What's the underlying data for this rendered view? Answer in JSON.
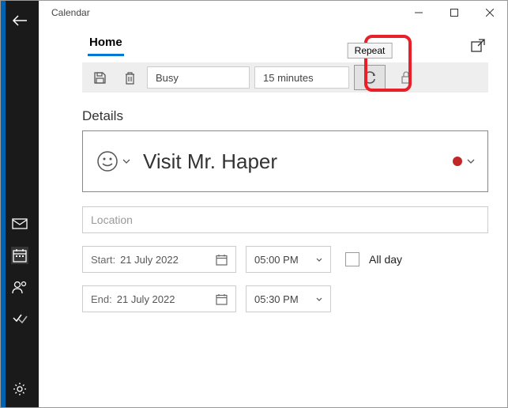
{
  "window": {
    "title": "Calendar"
  },
  "tabs": {
    "home": "Home"
  },
  "tooltip": {
    "repeat": "Repeat"
  },
  "toolbar": {
    "status": "Busy",
    "reminder": "15 minutes"
  },
  "details_label": "Details",
  "event": {
    "name": "Visit Mr. Haper",
    "location_placeholder": "Location"
  },
  "start": {
    "label": "Start:",
    "date": "21 July 2022",
    "time": "05:00 PM"
  },
  "end": {
    "label": "End:",
    "date": "21 July 2022",
    "time": "05:30 PM"
  },
  "allday_label": "All day"
}
